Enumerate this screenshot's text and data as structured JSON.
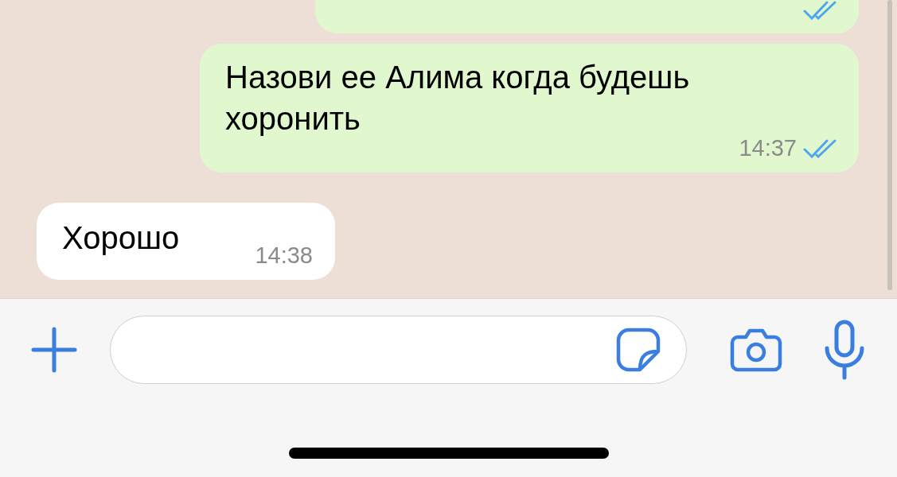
{
  "messages": [
    {
      "kind": "outgoing",
      "read": true
    },
    {
      "kind": "outgoing",
      "text": "Назови ее Алима когда будешь хоронить",
      "time": "14:37",
      "read": true
    },
    {
      "kind": "incoming",
      "text": "Хорошо",
      "time": "14:38"
    }
  ]
}
